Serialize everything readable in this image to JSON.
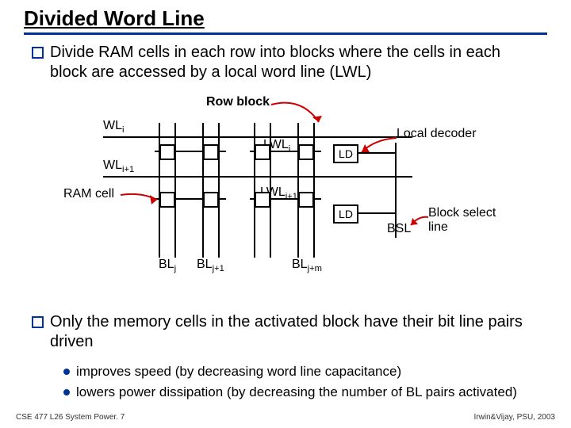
{
  "title": "Divided Word Line",
  "bullets": {
    "b1": "Divide RAM cells in each row into blocks where the cells in each block are accessed by a local word line (LWL)",
    "b2": "Only the memory cells in the activated block have their bit line pairs driven",
    "s1": "improves speed (by decreasing word line capacitance)",
    "s2": "lowers power dissipation (by decreasing the number of BL pairs activated)"
  },
  "diagram": {
    "row_block": "Row block",
    "wl_i": "WL",
    "wl_i_sub": "i",
    "wl_i1": "WL",
    "wl_i1_sub": "i+1",
    "lwl_i": "LWL",
    "lwl_i_sub": "i",
    "lwl_i1": "LWL",
    "lwl_i1_sub": "i+1",
    "ram_cell": "RAM cell",
    "local_decoder": "Local decoder",
    "ld1": "LD",
    "ld2": "LD",
    "bl_j": "BL",
    "bl_j_sub": "j",
    "bl_j1": "BL",
    "bl_j1_sub": "j+1",
    "bl_jm": "BL",
    "bl_jm_sub": "j+m",
    "bsl": "BSL",
    "block_select": "Block select line"
  },
  "footer": {
    "left": "CSE 477 L26 System Power. 7",
    "right": "Irwin&Vijay, PSU, 2003"
  }
}
